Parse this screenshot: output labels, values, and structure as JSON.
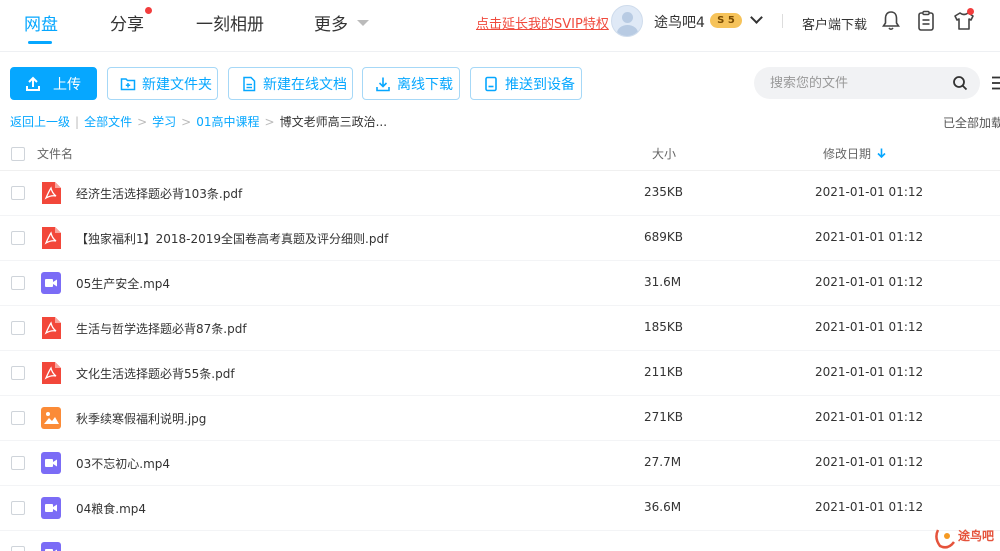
{
  "nav": {
    "items": [
      {
        "label": "网盘",
        "active": true
      },
      {
        "label": "分享",
        "dot": true
      },
      {
        "label": "一刻相册"
      },
      {
        "label": "更多"
      }
    ],
    "svip_link": "点击延长我的SVIP特权",
    "username": "途鸟吧4",
    "vip_level": "5",
    "client_download": "客户端下载"
  },
  "toolbar": {
    "upload": "上传",
    "new_folder": "新建文件夹",
    "new_doc": "新建在线文档",
    "offline_download": "离线下载",
    "push_device": "推送到设备",
    "search_placeholder": "搜索您的文件"
  },
  "breadcrumb": {
    "back": "返回上一级",
    "items": [
      "全部文件",
      "学习",
      "01高中课程"
    ],
    "current": "博文老师高三政治...",
    "loaded_status": "已全部加载"
  },
  "table": {
    "headers": {
      "name": "文件名",
      "size": "大小",
      "modified": "修改日期"
    },
    "rows": [
      {
        "type": "pdf",
        "name": "经济生活选择题必背103条.pdf",
        "size": "235KB",
        "date": "2021-01-01 01:12"
      },
      {
        "type": "pdf",
        "name": "【独家福利1】2018-2019全国卷高考真题及评分细则.pdf",
        "size": "689KB",
        "date": "2021-01-01 01:12"
      },
      {
        "type": "video",
        "name": "05生产安全.mp4",
        "size": "31.6M",
        "date": "2021-01-01 01:12"
      },
      {
        "type": "pdf",
        "name": "生活与哲学选择题必背87条.pdf",
        "size": "185KB",
        "date": "2021-01-01 01:12"
      },
      {
        "type": "pdf",
        "name": "文化生活选择题必背55条.pdf",
        "size": "211KB",
        "date": "2021-01-01 01:12"
      },
      {
        "type": "image",
        "name": "秋季续寒假福利说明.jpg",
        "size": "271KB",
        "date": "2021-01-01 01:12"
      },
      {
        "type": "video",
        "name": "03不忘初心.mp4",
        "size": "27.7M",
        "date": "2021-01-01 01:12"
      },
      {
        "type": "video",
        "name": "04粮食.mp4",
        "size": "36.6M",
        "date": "2021-01-01 01:12"
      },
      {
        "type": "video",
        "name": "",
        "size": "",
        "date": ""
      }
    ]
  },
  "watermark": {
    "text": "途鸟吧"
  },
  "colors": {
    "accent": "#06a7ff",
    "pdf": "#f2473a",
    "video": "#7b6cf6",
    "image": "#fb8b37",
    "svip": "#f04a3d"
  }
}
